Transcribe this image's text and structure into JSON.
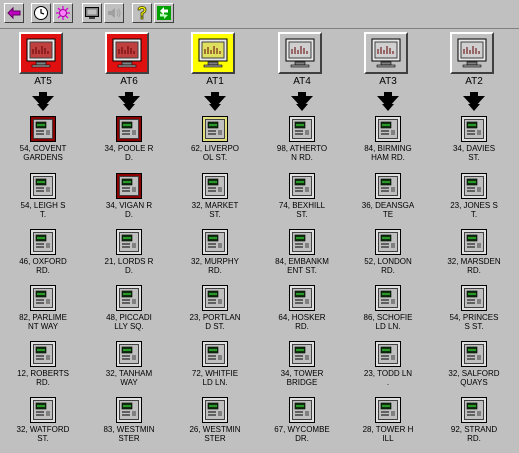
{
  "toolbar": {
    "buttons": [
      {
        "icon": "back-arrow-icon"
      },
      {
        "icon": "clock-icon"
      },
      {
        "icon": "sun-icon"
      },
      {
        "icon": "monitor-icon"
      },
      {
        "icon": "sound-icon"
      },
      {
        "icon": "help-icon"
      },
      {
        "icon": "refresh-icon"
      }
    ]
  },
  "colors": {
    "red": "#e01010",
    "yellow": "#ffff00",
    "grey": "#c0c0c0",
    "dark_red": "#8b0000"
  },
  "columns": [
    {
      "label": "AT5",
      "status": "red",
      "stations": [
        {
          "label": "54, COVENT\nGARDENS",
          "status": "red"
        },
        {
          "label": "54, LEIGH S\nT.",
          "status": "normal"
        },
        {
          "label": "46, OXFORD\nRD.",
          "status": "normal"
        },
        {
          "label": "82, PARLIME\nNT WAY",
          "status": "normal"
        },
        {
          "label": "12, ROBERTS\nRD.",
          "status": "normal"
        },
        {
          "label": "32, WATFORD\nST.",
          "status": "normal"
        }
      ]
    },
    {
      "label": "AT6",
      "status": "red",
      "stations": [
        {
          "label": "34, POOLE R\nD.",
          "status": "red"
        },
        {
          "label": "34, VIGAN R\nD.",
          "status": "red"
        },
        {
          "label": "21, LORDS R\nD.",
          "status": "normal"
        },
        {
          "label": "48, PICCADI\nLLY SQ.",
          "status": "normal"
        },
        {
          "label": "32, TANHAM\nWAY",
          "status": "normal"
        },
        {
          "label": "83, WESTMIN\nSTER",
          "status": "normal"
        }
      ]
    },
    {
      "label": "AT1",
      "status": "yellow",
      "stations": [
        {
          "label": "62, LIVERPO\nOL ST.",
          "status": "yellow"
        },
        {
          "label": "32, MARKET\nST.",
          "status": "normal"
        },
        {
          "label": "32, MURPHY\nRD.",
          "status": "normal"
        },
        {
          "label": "23, PORTLAN\nD ST.",
          "status": "normal"
        },
        {
          "label": "72, WHITFIE\nLD LN.",
          "status": "normal"
        },
        {
          "label": "26, WESTMIN\nSTER",
          "status": "normal"
        }
      ]
    },
    {
      "label": "AT4",
      "status": "normal",
      "stations": [
        {
          "label": "98, ATHERTO\nN RD.",
          "status": "normal"
        },
        {
          "label": "74, BEXHILL\nST.",
          "status": "normal"
        },
        {
          "label": "84, EMBANKM\nENT ST.",
          "status": "normal"
        },
        {
          "label": "64, HOSKER\nRD.",
          "status": "normal"
        },
        {
          "label": "34, TOWER\nBRIDGE",
          "status": "normal"
        },
        {
          "label": "67, WYCOMBE\nDR.",
          "status": "normal"
        }
      ]
    },
    {
      "label": "AT3",
      "status": "normal",
      "stations": [
        {
          "label": "84, BIRMING\nHAM RD.",
          "status": "normal"
        },
        {
          "label": "36, DEANSGA\nTE",
          "status": "normal"
        },
        {
          "label": "52, LONDON\nRD.",
          "status": "normal"
        },
        {
          "label": "86, SCHOFIE\nLD LN.",
          "status": "normal"
        },
        {
          "label": "23, TODD LN\n.",
          "status": "normal"
        },
        {
          "label": "28, TOWER H\nILL",
          "status": "normal"
        }
      ]
    },
    {
      "label": "AT2",
      "status": "normal",
      "stations": [
        {
          "label": "34, DAVIES\nST.",
          "status": "normal"
        },
        {
          "label": "23, JONES S\nT.",
          "status": "normal"
        },
        {
          "label": "32, MARSDEN\nRD.",
          "status": "normal"
        },
        {
          "label": "54, PRINCES\nS ST.",
          "status": "normal"
        },
        {
          "label": "32, SALFORD\nQUAYS",
          "status": "normal"
        },
        {
          "label": "92, STRAND\nRD.",
          "status": "normal"
        }
      ]
    }
  ]
}
